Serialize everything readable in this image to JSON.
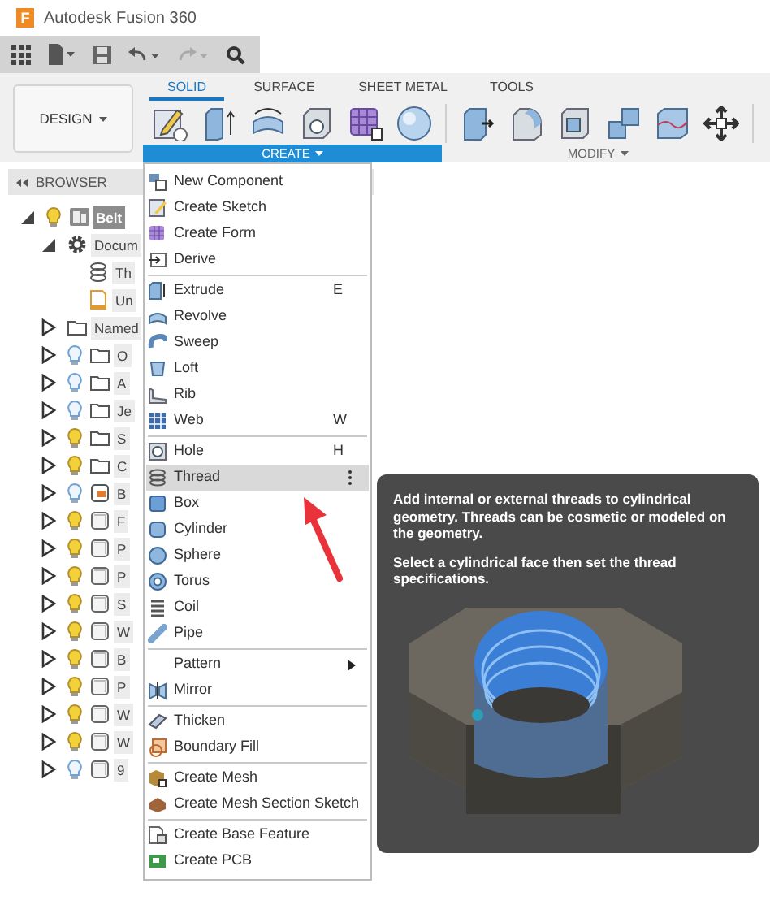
{
  "window": {
    "logo": "F",
    "title": "Autodesk Fusion 360"
  },
  "ribbon": {
    "workspace": "DESIGN",
    "tabs": [
      {
        "label": "SOLID",
        "selected": true
      },
      {
        "label": "SURFACE",
        "selected": false
      },
      {
        "label": "SHEET METAL",
        "selected": false
      },
      {
        "label": "TOOLS",
        "selected": false
      }
    ],
    "groups": [
      {
        "label": "CREATE",
        "active": true
      },
      {
        "label": "MODIFY",
        "active": false
      }
    ]
  },
  "browser": {
    "title": "BROWSER",
    "tree": [
      {
        "label": "Belt",
        "kind": "root",
        "expanded": true,
        "visible": true,
        "selected": true,
        "children": [
          {
            "label": "Docum",
            "kind": "settings",
            "expanded": true,
            "selected": false,
            "children": [
              {
                "label": "Th",
                "kind": "thread",
                "selected": false
              },
              {
                "label": "Un",
                "kind": "document",
                "selected": false
              }
            ]
          },
          {
            "label": "Named",
            "kind": "folder",
            "expanded": false,
            "selected": false
          },
          {
            "label": "O",
            "kind": "folder",
            "expanded": false,
            "visible": false,
            "selected": false
          },
          {
            "label": "A",
            "kind": "folder",
            "expanded": false,
            "visible": false,
            "selected": false
          },
          {
            "label": "Je",
            "kind": "folder",
            "expanded": false,
            "visible": false,
            "selected": false
          },
          {
            "label": "S",
            "kind": "folder",
            "expanded": false,
            "visible": true,
            "selected": false
          },
          {
            "label": "C",
            "kind": "folder",
            "expanded": false,
            "visible": true,
            "selected": false
          },
          {
            "label": "B",
            "kind": "component",
            "expanded": false,
            "visible": false,
            "selected": false
          },
          {
            "label": "F",
            "kind": "body",
            "expanded": false,
            "visible": true,
            "selected": false
          },
          {
            "label": "P",
            "kind": "body",
            "expanded": false,
            "visible": true,
            "selected": false
          },
          {
            "label": "P",
            "kind": "body",
            "expanded": false,
            "visible": true,
            "selected": false
          },
          {
            "label": "S",
            "kind": "body",
            "expanded": false,
            "visible": true,
            "selected": false
          },
          {
            "label": "W",
            "kind": "body",
            "expanded": false,
            "visible": true,
            "selected": false
          },
          {
            "label": "B",
            "kind": "body",
            "expanded": false,
            "visible": true,
            "selected": false
          },
          {
            "label": "P",
            "kind": "body",
            "expanded": false,
            "visible": true,
            "selected": false
          },
          {
            "label": "W",
            "kind": "body",
            "expanded": false,
            "visible": true,
            "selected": false
          },
          {
            "label": "W",
            "kind": "body",
            "expanded": false,
            "visible": true,
            "selected": false
          },
          {
            "label": "9",
            "kind": "body",
            "expanded": false,
            "visible": false,
            "selected": false
          }
        ]
      }
    ]
  },
  "menu": {
    "sections": [
      {
        "items": [
          {
            "label": "New Component",
            "selected": false,
            "submenu": false
          },
          {
            "label": "Create Sketch",
            "selected": false,
            "submenu": false
          },
          {
            "label": "Create Form",
            "selected": false,
            "submenu": false
          },
          {
            "label": "Derive",
            "selected": false,
            "submenu": false
          }
        ]
      },
      {
        "items": [
          {
            "label": "Extrude",
            "shortcut": "E",
            "selected": false,
            "submenu": false
          },
          {
            "label": "Revolve",
            "selected": false,
            "submenu": false
          },
          {
            "label": "Sweep",
            "selected": false,
            "submenu": false
          },
          {
            "label": "Loft",
            "selected": false,
            "submenu": false
          },
          {
            "label": "Rib",
            "selected": false,
            "submenu": false
          },
          {
            "label": "Web",
            "shortcut": "W",
            "selected": false,
            "submenu": false
          }
        ]
      },
      {
        "items": [
          {
            "label": "Hole",
            "shortcut": "H",
            "selected": false,
            "submenu": false
          },
          {
            "label": "Thread",
            "selected": true,
            "submenu": false
          },
          {
            "label": "Box",
            "selected": false,
            "submenu": false
          },
          {
            "label": "Cylinder",
            "selected": false,
            "submenu": false
          },
          {
            "label": "Sphere",
            "selected": false,
            "submenu": false
          },
          {
            "label": "Torus",
            "selected": false,
            "submenu": false
          },
          {
            "label": "Coil",
            "selected": false,
            "submenu": false
          },
          {
            "label": "Pipe",
            "selected": false,
            "submenu": false
          }
        ]
      },
      {
        "items": [
          {
            "label": "Pattern",
            "selected": false,
            "submenu": true
          },
          {
            "label": "Mirror",
            "selected": false,
            "submenu": false
          }
        ]
      },
      {
        "items": [
          {
            "label": "Thicken",
            "selected": false,
            "submenu": false
          },
          {
            "label": "Boundary Fill",
            "selected": false,
            "submenu": false
          }
        ]
      },
      {
        "items": [
          {
            "label": "Create Mesh",
            "selected": false,
            "submenu": false
          },
          {
            "label": "Create Mesh Section Sketch",
            "selected": false,
            "submenu": false
          }
        ]
      },
      {
        "items": [
          {
            "label": "Create Base Feature",
            "selected": false,
            "submenu": false
          },
          {
            "label": "Create PCB",
            "selected": false,
            "submenu": false
          }
        ]
      }
    ]
  },
  "tooltip": {
    "paragraphs": [
      "Add internal or external threads to cylindrical geometry. Threads can be cosmetic or modeled on the geometry.",
      "Select a cylindrical face then set the thread specifications."
    ]
  }
}
